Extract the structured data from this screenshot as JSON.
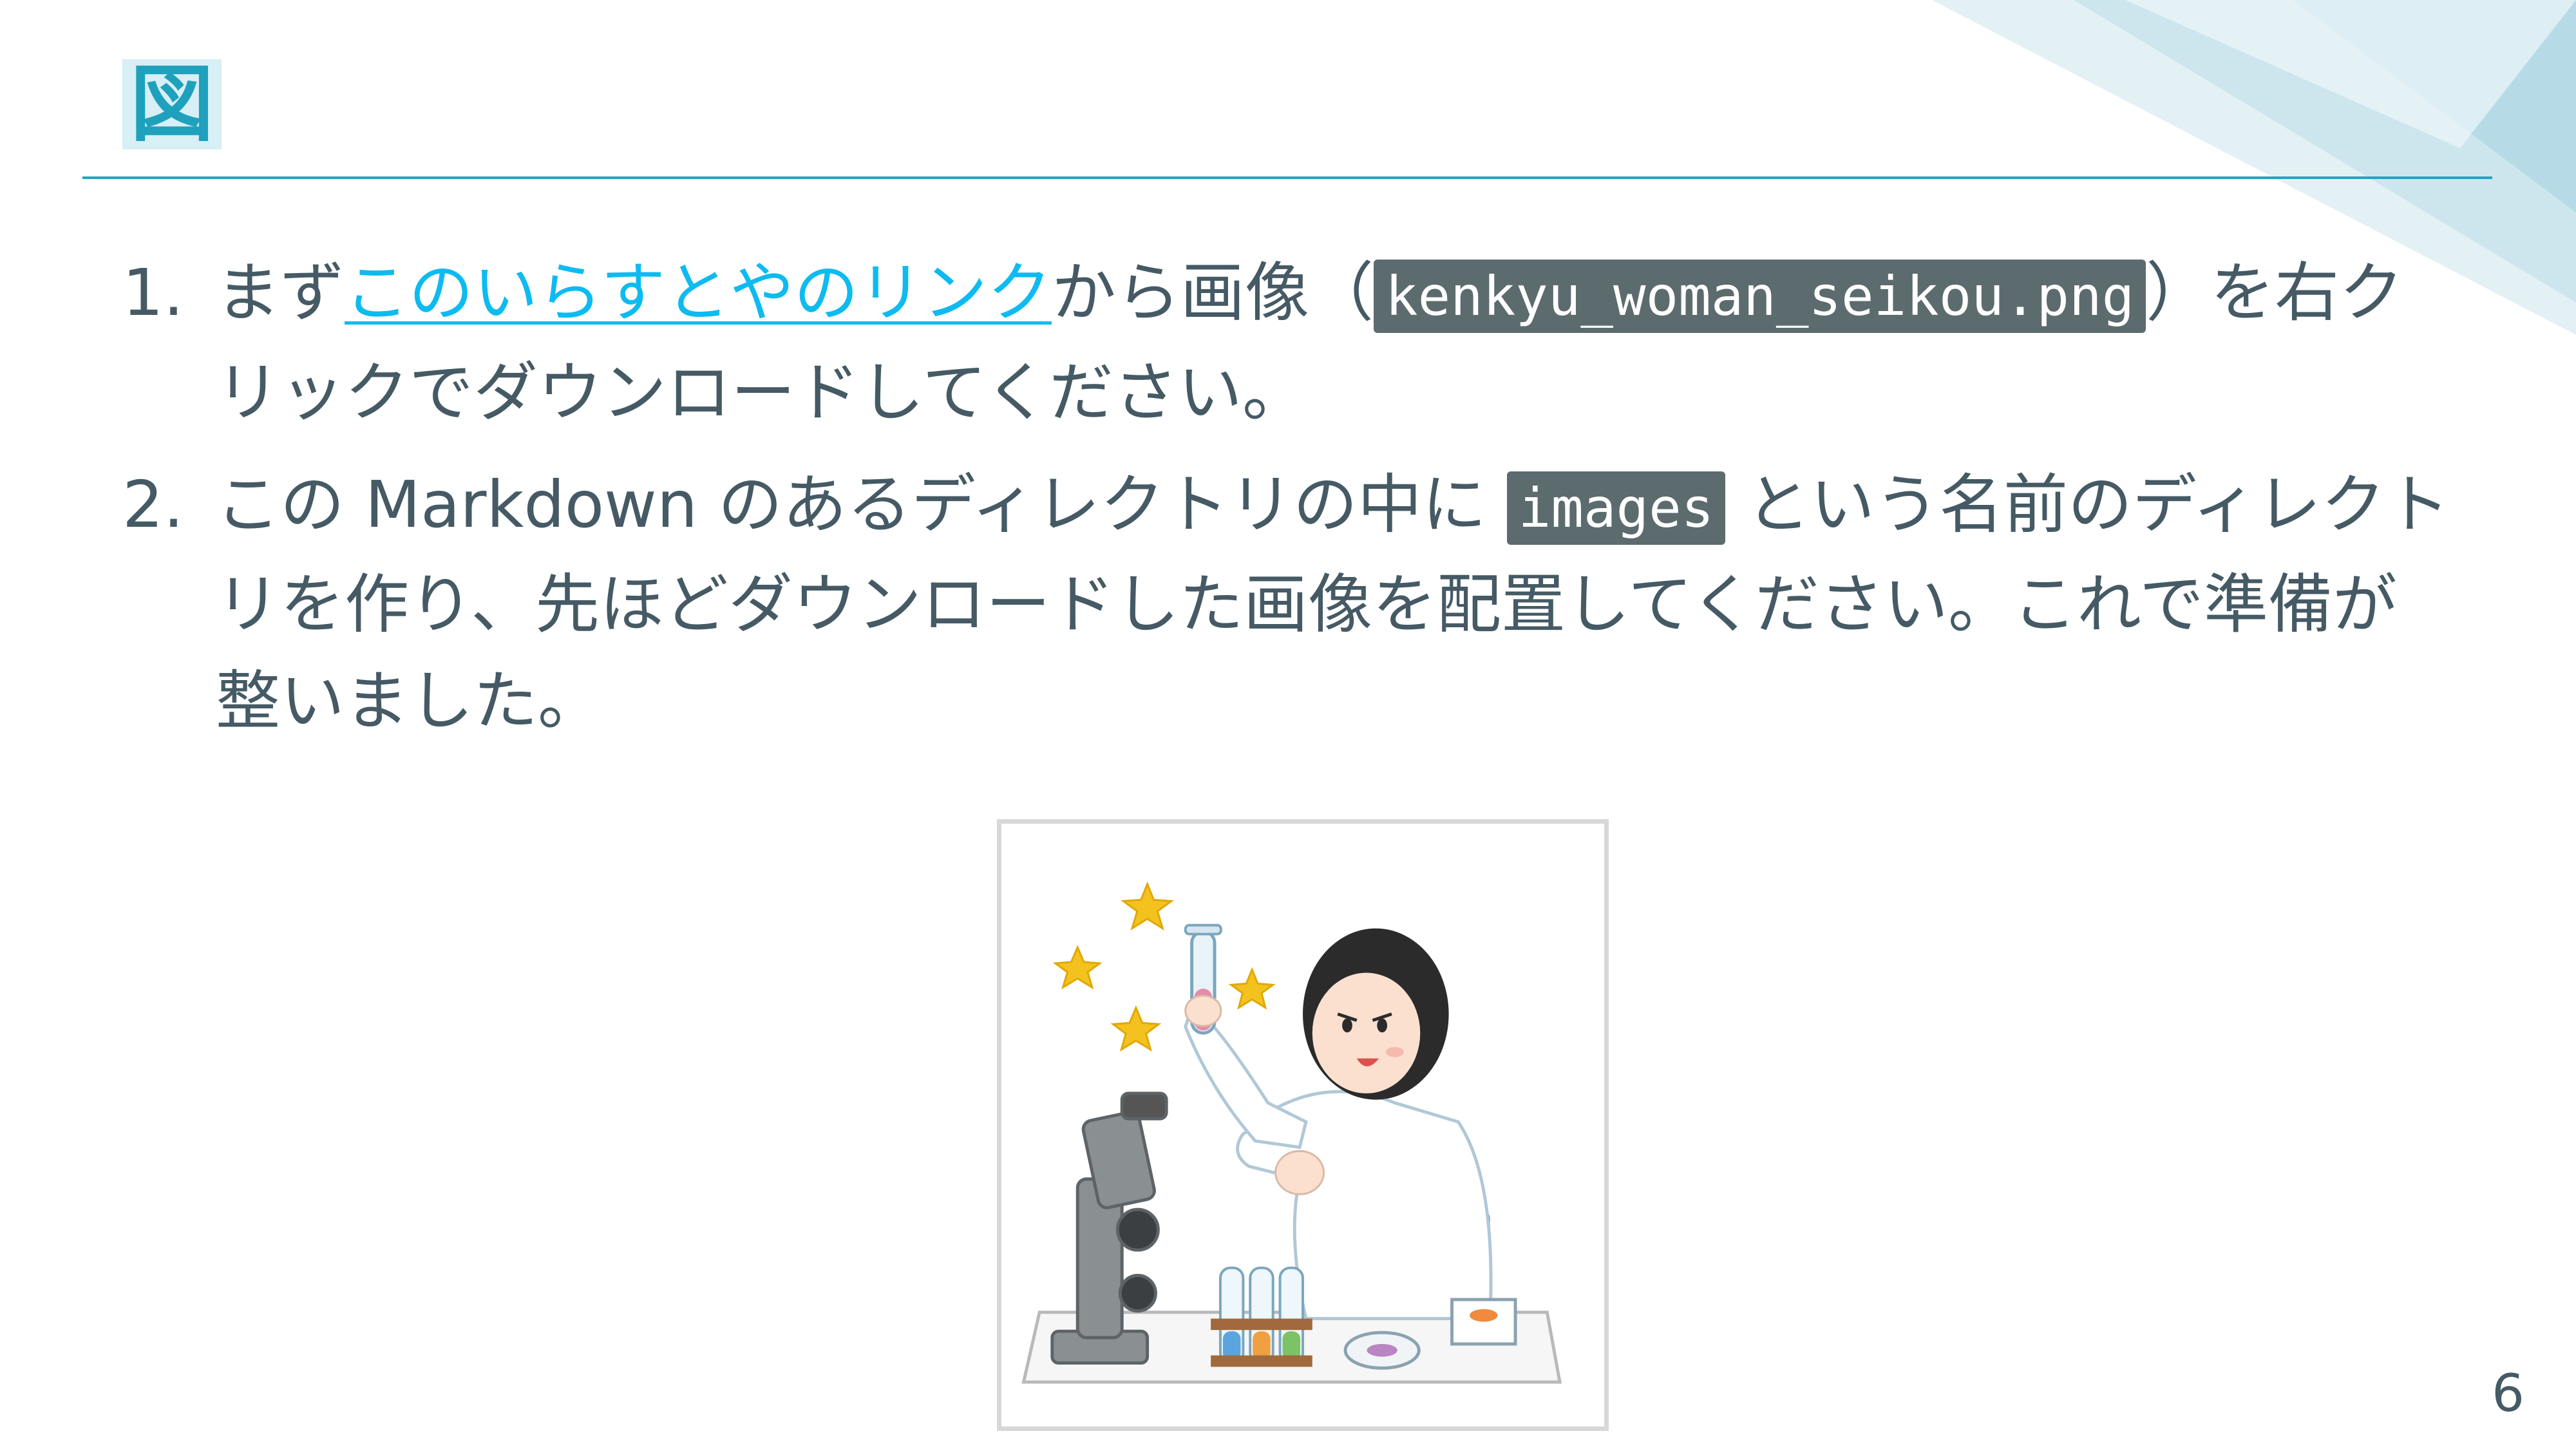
{
  "slide": {
    "title": "図",
    "page_number": "6",
    "steps": [
      {
        "number": "1.",
        "prefix": "まず",
        "link_text": "このいらすとやのリンク",
        "middle": "から画像（",
        "code": "kenkyu_woman_seikou.png",
        "suffix": "）を右クリックでダウンロードしてください。"
      },
      {
        "number": "2.",
        "prefix": "この Markdown のあるディレクトリの中に ",
        "code": "images",
        "suffix": " という名前のディレクトリを作り、先ほどダウンロードした画像を配置してください。これで準備が整いました。"
      }
    ]
  }
}
